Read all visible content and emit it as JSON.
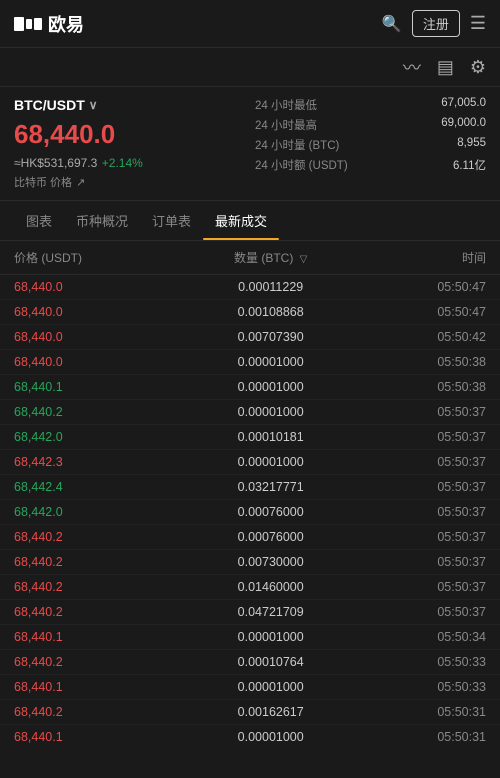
{
  "header": {
    "logo_text": "欧易",
    "register_btn": "注册",
    "search_icon": "search",
    "menu_icon": "menu"
  },
  "sub_header": {
    "icons": [
      "chart-wave",
      "list-icon",
      "gear-icon"
    ]
  },
  "price_section": {
    "pair": "BTC/USDT",
    "pair_arrow": "∨",
    "price_main": "68,440.0",
    "price_hkd": "≈HK$531,697.3",
    "price_change": "+2.14%",
    "price_label": "比特币 价格",
    "stats": [
      {
        "label": "24 小时最低",
        "value": "67,005.0"
      },
      {
        "label": "24 小时最高",
        "value": "69,000.0"
      },
      {
        "label": "24 小时量 (BTC)",
        "value": "8,955"
      },
      {
        "label": "24 小时额 (USDT)",
        "value": "6.11亿"
      }
    ]
  },
  "tabs": [
    {
      "label": "图表",
      "active": false
    },
    {
      "label": "币种概况",
      "active": false
    },
    {
      "label": "订单表",
      "active": false
    },
    {
      "label": "最新成交",
      "active": true
    }
  ],
  "table": {
    "headers": {
      "price": "价格 (USDT)",
      "amount": "数量 (BTC)",
      "time": "时间"
    },
    "rows": [
      {
        "price": "68,440.0",
        "color": "red",
        "amount": "0.00011229",
        "time": "05:50:47"
      },
      {
        "price": "68,440.0",
        "color": "red",
        "amount": "0.00108868",
        "time": "05:50:47"
      },
      {
        "price": "68,440.0",
        "color": "red",
        "amount": "0.00707390",
        "time": "05:50:42"
      },
      {
        "price": "68,440.0",
        "color": "red",
        "amount": "0.00001000",
        "time": "05:50:38"
      },
      {
        "price": "68,440.1",
        "color": "green",
        "amount": "0.00001000",
        "time": "05:50:38"
      },
      {
        "price": "68,440.2",
        "color": "green",
        "amount": "0.00001000",
        "time": "05:50:37"
      },
      {
        "price": "68,442.0",
        "color": "green",
        "amount": "0.00010181",
        "time": "05:50:37"
      },
      {
        "price": "68,442.3",
        "color": "red",
        "amount": "0.00001000",
        "time": "05:50:37"
      },
      {
        "price": "68,442.4",
        "color": "green",
        "amount": "0.03217771",
        "time": "05:50:37"
      },
      {
        "price": "68,442.0",
        "color": "green",
        "amount": "0.00076000",
        "time": "05:50:37"
      },
      {
        "price": "68,440.2",
        "color": "red",
        "amount": "0.00076000",
        "time": "05:50:37"
      },
      {
        "price": "68,440.2",
        "color": "red",
        "amount": "0.00730000",
        "time": "05:50:37"
      },
      {
        "price": "68,440.2",
        "color": "red",
        "amount": "0.01460000",
        "time": "05:50:37"
      },
      {
        "price": "68,440.2",
        "color": "red",
        "amount": "0.04721709",
        "time": "05:50:37"
      },
      {
        "price": "68,440.1",
        "color": "red",
        "amount": "0.00001000",
        "time": "05:50:34"
      },
      {
        "price": "68,440.2",
        "color": "red",
        "amount": "0.00010764",
        "time": "05:50:33"
      },
      {
        "price": "68,440.1",
        "color": "red",
        "amount": "0.00001000",
        "time": "05:50:33"
      },
      {
        "price": "68,440.2",
        "color": "red",
        "amount": "0.00162617",
        "time": "05:50:31"
      },
      {
        "price": "68,440.1",
        "color": "red",
        "amount": "0.00001000",
        "time": "05:50:31"
      }
    ]
  }
}
